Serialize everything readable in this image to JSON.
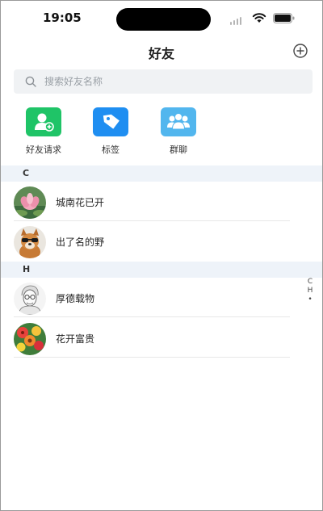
{
  "status_bar": {
    "time": "19:05"
  },
  "nav": {
    "title": "好友",
    "add_icon": "plus-circle-icon"
  },
  "search": {
    "placeholder": "搜索好友名称",
    "value": ""
  },
  "shortcuts": [
    {
      "label": "好友请求",
      "icon": "add-user-icon",
      "color": "#1fc467"
    },
    {
      "label": "标签",
      "icon": "tag-icon",
      "color": "#1f8ef1"
    },
    {
      "label": "群聊",
      "icon": "group-icon",
      "color": "#52b6ee"
    }
  ],
  "sections": [
    {
      "letter": "C",
      "contacts": [
        {
          "name": "城南花已开",
          "avatar": "lotus-flower-avatar"
        },
        {
          "name": "出了名的野",
          "avatar": "dog-with-sunglasses-avatar"
        }
      ]
    },
    {
      "letter": "H",
      "contacts": [
        {
          "name": "厚德载物",
          "avatar": "sketched-man-portrait-avatar"
        },
        {
          "name": "花开富贵",
          "avatar": "flower-painting-avatar"
        }
      ]
    }
  ],
  "index_bar": [
    "C",
    "H",
    "•"
  ],
  "colors": {
    "section_bg": "#eef3f9",
    "search_bg": "#f0f2f4"
  }
}
